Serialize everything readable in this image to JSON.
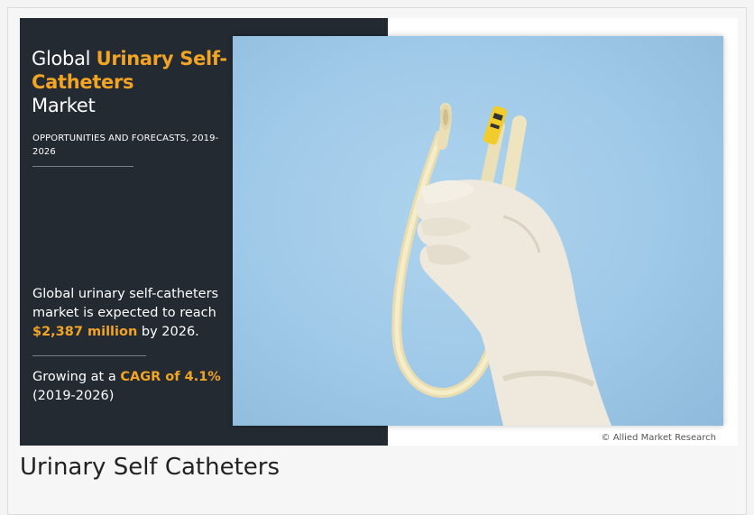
{
  "infographic": {
    "title_prefix": "Global ",
    "title_accent": "Urinary Self-Catheters",
    "title_suffix": "Market",
    "subtitle": "OPPORTUNITIES AND FORECASTS, 2019-2026",
    "stat_text": "Global urinary self-catheters market is expected to reach",
    "stat_value": "$2,387 million",
    "stat_suffix": " by 2026.",
    "growth_prefix": "Growing at a ",
    "growth_value": "CAGR of 4.1%",
    "growth_period": "(2019-2026)",
    "credit": "© Allied Market Research",
    "accent_color": "#f2a424",
    "panel_color": "#232a31"
  },
  "caption": "Urinary Self Catheters"
}
